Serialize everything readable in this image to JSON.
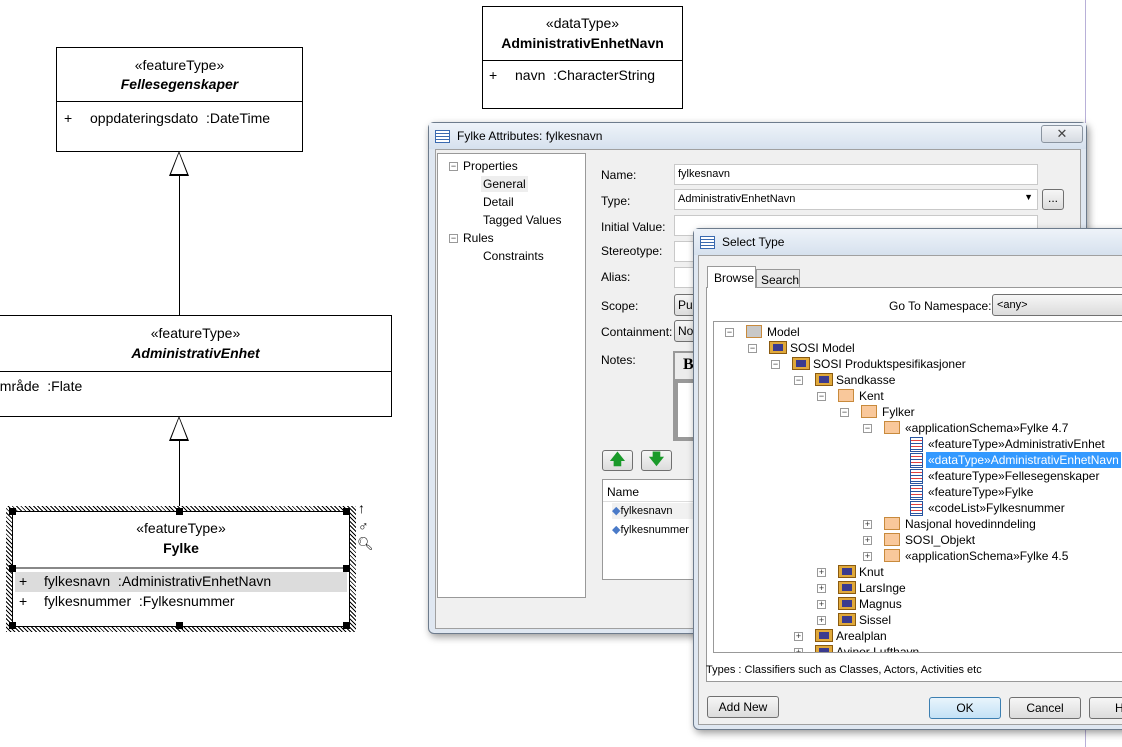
{
  "diagram": {
    "fellesegenskaper": {
      "stereotype": "«featureType»",
      "name": "Fellesegenskaper",
      "attributes": [
        {
          "vis": "+",
          "text": "oppdateringsdato  :DateTime"
        }
      ]
    },
    "administrativ_enhet": {
      "stereotype": "«featureType»",
      "name": "AdministrativEnhet",
      "attributes": [
        {
          "text": "område  :Flate"
        }
      ]
    },
    "fylke": {
      "stereotype": "«featureType»",
      "name": "Fylke",
      "attributes": [
        {
          "vis": "+",
          "text": "fylkesnavn  :AdministrativEnhetNavn"
        },
        {
          "vis": "+",
          "text": "fylkesnummer  :Fylkesnummer"
        }
      ]
    },
    "administrativ_enhet_navn": {
      "stereotype": "«dataType»",
      "name": "AdministrativEnhetNavn",
      "attributes": [
        {
          "vis": "+",
          "text": "navn  :CharacterString"
        }
      ]
    }
  },
  "attributes_dialog": {
    "title": "Fylke Attributes: fylkesnavn",
    "nav": [
      "Properties",
      "General",
      "Detail",
      "Tagged Values",
      "Rules",
      "Constraints"
    ],
    "labels": {
      "name": "Name:",
      "type": "Type:",
      "initial": "Initial Value:",
      "stereotype": "Stereotype:",
      "alias": "Alias:",
      "scope": "Scope:",
      "containment": "Containment:",
      "notes": "Notes:"
    },
    "name_value": "fylkesnavn",
    "type_value": "AdministrativEnhetNavn",
    "scope_value": "Pub",
    "containment_value": "Not",
    "notes_bold": "B",
    "browse_btn": "...",
    "list_header": "Name",
    "list_items": [
      "fylkesnavn",
      "fylkesnummer"
    ]
  },
  "select_type": {
    "title": "Select Type",
    "tabs": [
      "Browse",
      "Search"
    ],
    "namespace_label": "Go To Namespace:",
    "namespace_value": "<any>",
    "tree": [
      {
        "level": 0,
        "label": "Model",
        "icon": "model",
        "exp": "-"
      },
      {
        "level": 1,
        "label": "SOSI Model",
        "icon": "package",
        "exp": "-"
      },
      {
        "level": 2,
        "label": "SOSI Produktspesifikasjoner",
        "icon": "package",
        "exp": "-"
      },
      {
        "level": 3,
        "label": "Sandkasse",
        "icon": "package",
        "exp": "-"
      },
      {
        "level": 4,
        "label": "Kent",
        "icon": "folder",
        "exp": "-"
      },
      {
        "level": 5,
        "label": "Fylker",
        "icon": "folder",
        "exp": "-"
      },
      {
        "level": 6,
        "label": "«applicationSchema»Fylke 4.7",
        "icon": "folder",
        "exp": "-"
      },
      {
        "level": 7,
        "label": "«featureType»AdministrativEnhet",
        "icon": "class"
      },
      {
        "level": 7,
        "label": "«dataType»AdministrativEnhetNavn",
        "icon": "class",
        "selected": true
      },
      {
        "level": 7,
        "label": "«featureType»Fellesegenskaper",
        "icon": "class"
      },
      {
        "level": 7,
        "label": "«featureType»Fylke",
        "icon": "class"
      },
      {
        "level": 7,
        "label": "«codeList»Fylkesnummer",
        "icon": "class"
      },
      {
        "level": 6,
        "label": "Nasjonal hovedinndeling",
        "icon": "folder",
        "exp": "+"
      },
      {
        "level": 6,
        "label": "SOSI_Objekt",
        "icon": "folder",
        "exp": "+"
      },
      {
        "level": 6,
        "label": "«applicationSchema»Fylke 4.5",
        "icon": "folder",
        "exp": "+"
      },
      {
        "level": 4,
        "label": "Knut",
        "icon": "package",
        "exp": "+"
      },
      {
        "level": 4,
        "label": "LarsInge",
        "icon": "package",
        "exp": "+"
      },
      {
        "level": 4,
        "label": "Magnus",
        "icon": "package",
        "exp": "+"
      },
      {
        "level": 4,
        "label": "Sissel",
        "icon": "package",
        "exp": "+"
      },
      {
        "level": 3,
        "label": "Arealplan",
        "icon": "package",
        "exp": "+"
      },
      {
        "level": 3,
        "label": "Avinor Lufthavn",
        "icon": "package",
        "exp": "+"
      }
    ],
    "status": "Types : Classifiers such as Classes, Actors, Activities etc",
    "buttons": {
      "add_new": "Add New",
      "ok": "OK",
      "cancel": "Cancel",
      "help": "H"
    },
    "selection_color": "#3399ff"
  }
}
